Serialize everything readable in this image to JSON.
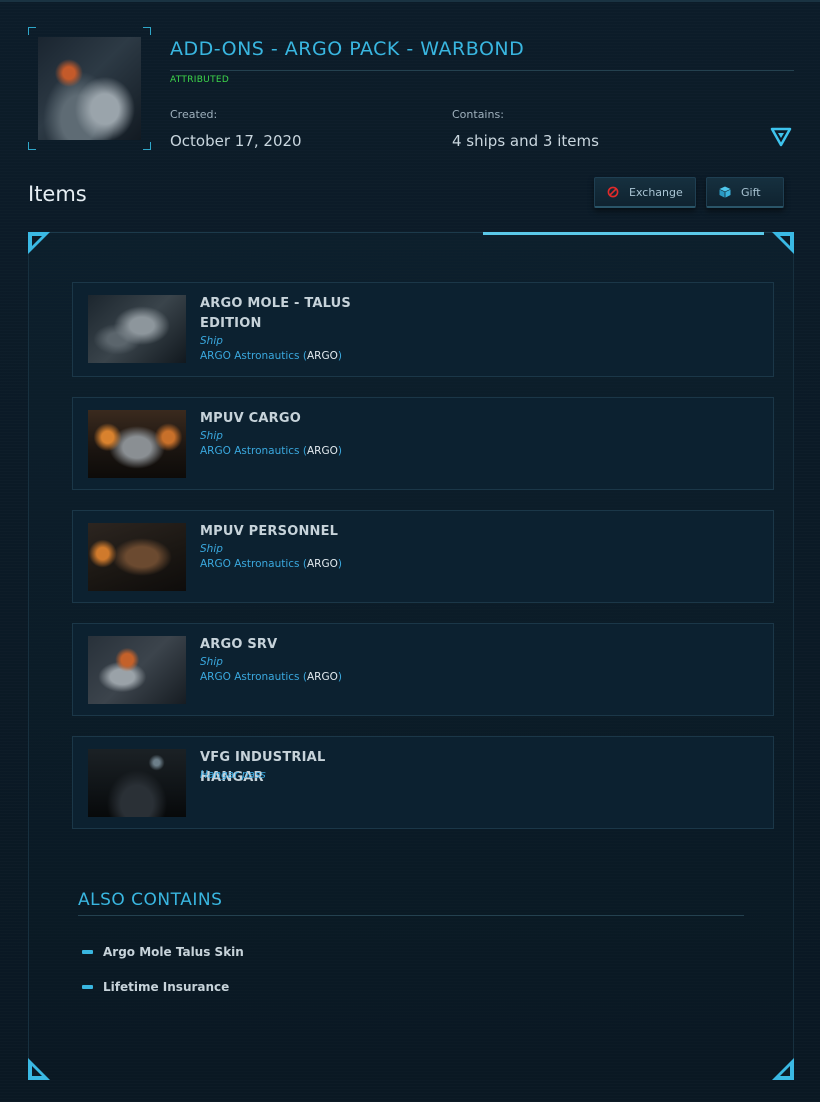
{
  "pack": {
    "title": "ADD-ONS - ARGO PACK - WARBOND",
    "status": "ATTRIBUTED",
    "created_label": "Created:",
    "created_value": "October 17, 2020",
    "contains_label": "Contains:",
    "contains_value": "4 ships and 3 items"
  },
  "section": {
    "items_heading": "Items",
    "exchange_label": "Exchange",
    "gift_label": "Gift"
  },
  "items": [
    {
      "name": "ARGO MOLE - TALUS EDITION",
      "type": "Ship",
      "maker": "ARGO Astronautics",
      "code": "ARGO"
    },
    {
      "name": "MPUV CARGO",
      "type": "Ship",
      "maker": "ARGO Astronautics",
      "code": "ARGO"
    },
    {
      "name": "MPUV PERSONNEL",
      "type": "Ship",
      "maker": "ARGO Astronautics",
      "code": "ARGO"
    },
    {
      "name": "ARGO SRV",
      "type": "Ship",
      "maker": "ARGO Astronautics",
      "code": "ARGO"
    },
    {
      "name": "VFG INDUSTRIAL HANGAR",
      "type": "Hangar pass"
    }
  ],
  "also_contains": {
    "heading": "ALSO CONTAINS",
    "items": [
      "Argo Mole Talus Skin",
      "Lifetime Insurance"
    ]
  },
  "icons": {
    "expand": "chevron-down-triangle-icon",
    "exchange": "prohibited-circle-icon",
    "gift": "cube-icon"
  },
  "colors": {
    "accent": "#39b6e0",
    "status_green": "#3dd64a",
    "background": "#0b1a26"
  }
}
